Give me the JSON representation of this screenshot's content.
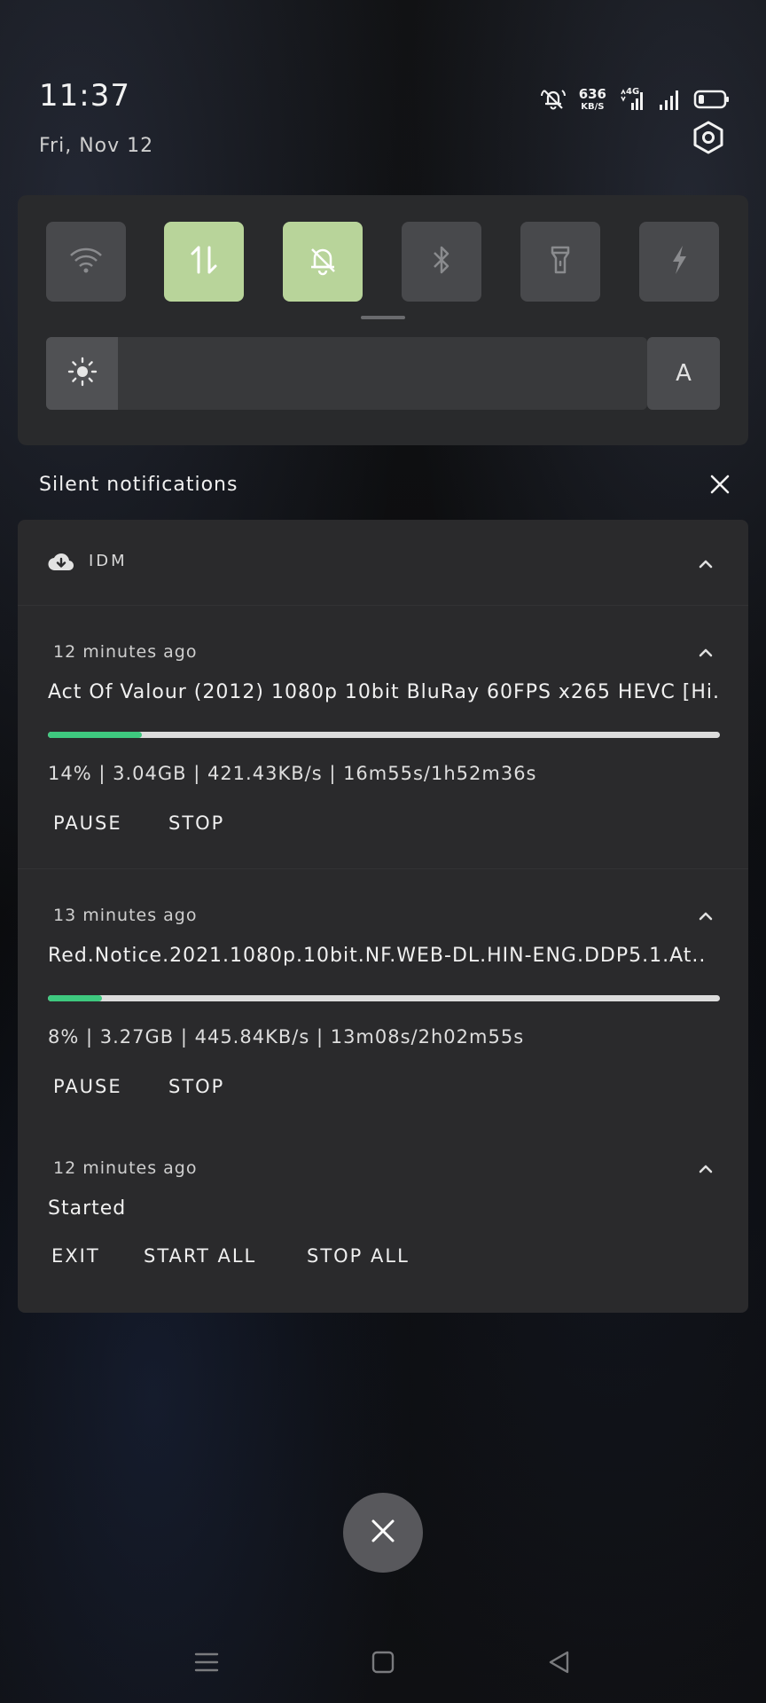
{
  "status_bar": {
    "time": "11:37",
    "date": "Fri, Nov 12",
    "net_speed_value": "636",
    "net_speed_unit": "KB/S",
    "network_type": "4G",
    "icons": [
      "mute-bell-icon",
      "net-speed",
      "signal-4g-icon",
      "signal-icon",
      "battery-icon"
    ]
  },
  "quick_settings": {
    "tiles": [
      {
        "name": "wifi",
        "icon": "wifi-icon",
        "active": false
      },
      {
        "name": "mobile-data",
        "icon": "data-arrows-icon",
        "active": true
      },
      {
        "name": "silent",
        "icon": "bell-off-icon",
        "active": true
      },
      {
        "name": "bluetooth",
        "icon": "bluetooth-icon",
        "active": false
      },
      {
        "name": "flashlight",
        "icon": "flashlight-icon",
        "active": false
      },
      {
        "name": "power-saver",
        "icon": "lightning-icon",
        "active": false
      }
    ],
    "brightness_level": 0.12,
    "auto_label": "A"
  },
  "notifications_section": {
    "title": "Silent notifications"
  },
  "app": {
    "name": "IDM",
    "icon": "cloud-download-icon"
  },
  "notifications": [
    {
      "time": "12 minutes ago",
      "title": "Act Of Valour (2012) 1080p 10bit BluRay 60FPS x265 HEVC [Hi..",
      "progress": 0.14,
      "stats": "14% | 3.04GB | 421.43KB/s | 16m55s/1h52m36s",
      "actions": [
        "PAUSE",
        "STOP"
      ]
    },
    {
      "time": "13 minutes ago",
      "title": "Red.Notice.2021.1080p.10bit.NF.WEB-DL.HIN-ENG.DDP5.1.At..",
      "progress": 0.08,
      "stats": "8% | 3.27GB | 445.84KB/s | 13m08s/2h02m55s",
      "actions": [
        "PAUSE",
        "STOP"
      ]
    },
    {
      "time": "12 minutes ago",
      "title": "Started",
      "actions": [
        "EXIT",
        "START ALL",
        "STOP ALL"
      ]
    }
  ],
  "colors": {
    "accent_tile": "#b8d49a",
    "progress": "#3ec97f",
    "card_bg": "#2a2a2c"
  },
  "nav_bar": {
    "icons": [
      "menu-icon",
      "home-icon",
      "back-icon"
    ]
  }
}
